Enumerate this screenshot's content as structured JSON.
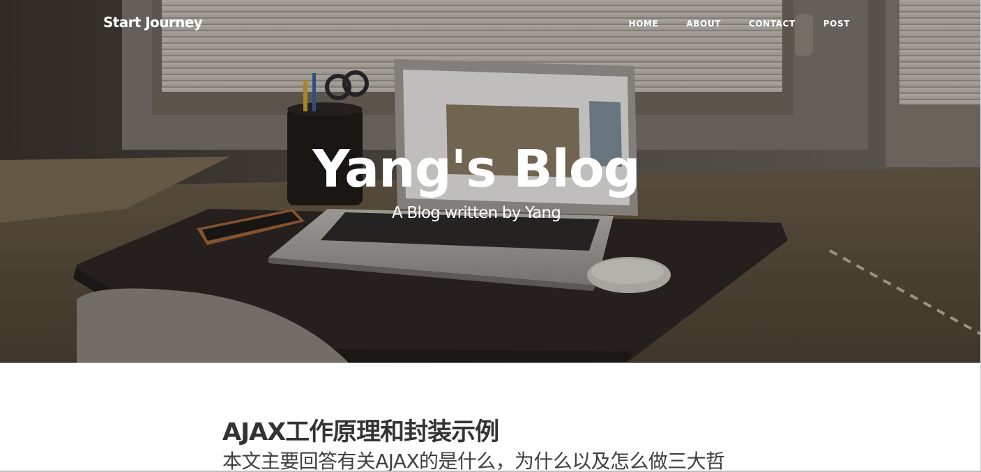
{
  "navbar": {
    "brand": "Start Journey",
    "links": [
      {
        "label": "HOME"
      },
      {
        "label": "ABOUT"
      },
      {
        "label": "CONTACT"
      },
      {
        "label": "POST"
      }
    ]
  },
  "hero": {
    "title": "Yang's Blog",
    "subtitle": "A Blog written by Yang"
  },
  "posts": [
    {
      "title": "AJAX工作原理和封装示例",
      "subtitle": "本文主要回答有关AJAX的是什么，为什么以及怎么做三大哲"
    }
  ],
  "colors": {
    "text_dark": "#333333",
    "text_body": "#404040",
    "hero_text": "#ffffff"
  }
}
